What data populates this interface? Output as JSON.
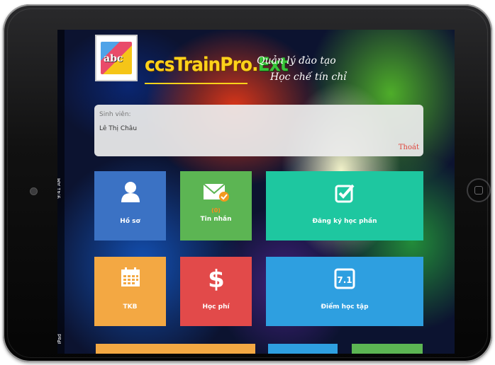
{
  "app": {
    "brand_main": "ccsTrainPro.",
    "brand_ext": "Ext",
    "tagline_line1": "Quản lý đào tạo",
    "tagline_line2": "Học chế tín chỉ"
  },
  "status_bar": {
    "time": "9:41 AM",
    "carrier": "iPad"
  },
  "student": {
    "label": "Sinh viên:",
    "name": "Lê Thị Châu",
    "logout_label": "Thoát"
  },
  "tiles": {
    "profile": {
      "label": "Hồ sơ",
      "icon": "user-icon",
      "color": "#3b72c4"
    },
    "messages": {
      "label": "Tin nhắn",
      "count": "(0)",
      "icon": "envelope-icon",
      "color": "#5cb553"
    },
    "course_registration": {
      "label": "Đăng ký học phần",
      "icon": "checkbox-icon",
      "color": "#1ec7a0"
    },
    "timetable": {
      "label": "TKB",
      "icon": "calendar-icon",
      "color": "#f3a843"
    },
    "tuition": {
      "label": "Học phí",
      "icon": "dollar-icon",
      "color": "#e24a4a"
    },
    "grades": {
      "label": "Điểm học tập",
      "icon": "grade-icon",
      "color": "#2e9fe0"
    }
  }
}
